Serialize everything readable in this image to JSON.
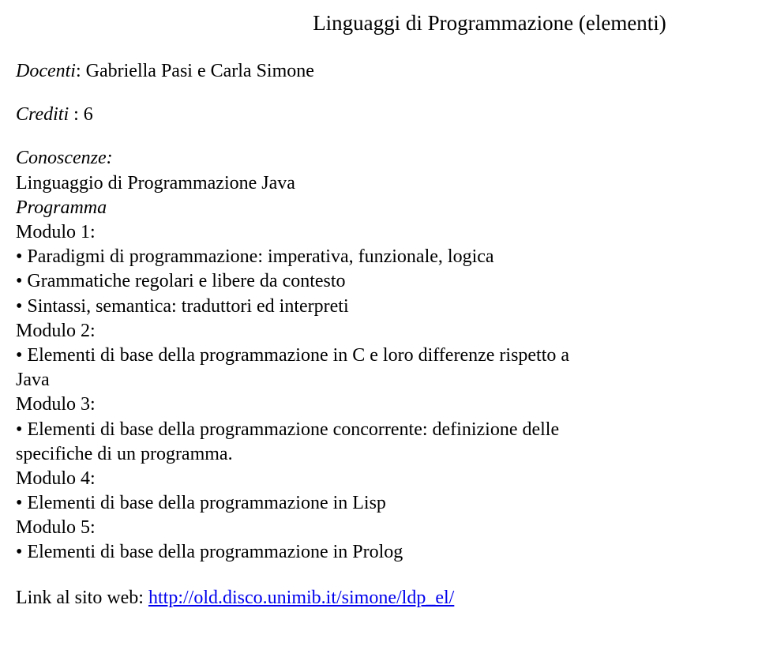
{
  "title": "Linguaggi di Programmazione (elementi)",
  "docenti_label": "Docenti",
  "docenti_value": ": Gabriella Pasi e Carla Simone",
  "crediti_label": "Crediti ",
  "crediti_value": ": 6",
  "conoscenze_label": "Conoscenze:",
  "conoscenze_value": "Linguaggio di Programmazione Java",
  "programma_label": "Programma",
  "modulo1_label": "Modulo 1:",
  "modulo1_b1": "Paradigmi di programmazione: imperativa, funzionale, logica",
  "modulo1_b2": "Grammatiche regolari e libere da contesto",
  "modulo1_b3": "Sintassi, semantica: traduttori ed interpreti",
  "modulo2_label": "Modulo 2:",
  "modulo2_b1_a": "Elementi di base della programmazione in C e loro differenze rispetto a",
  "modulo2_b1_b": "Java",
  "modulo3_label": "Modulo 3:",
  "modulo3_b1_a": "Elementi di base della programmazione concorrente: definizione delle",
  "modulo3_b1_b": "specifiche di un programma.",
  "modulo4_label": "Modulo 4:",
  "modulo4_b1": "Elementi di base della programmazione in Lisp",
  "modulo5_label": "Modulo 5:",
  "modulo5_b1": "Elementi di base della programmazione in Prolog",
  "link_label": "Link al sito web: ",
  "link_url": "http://old.disco.unimib.it/simone/ldp_el/"
}
